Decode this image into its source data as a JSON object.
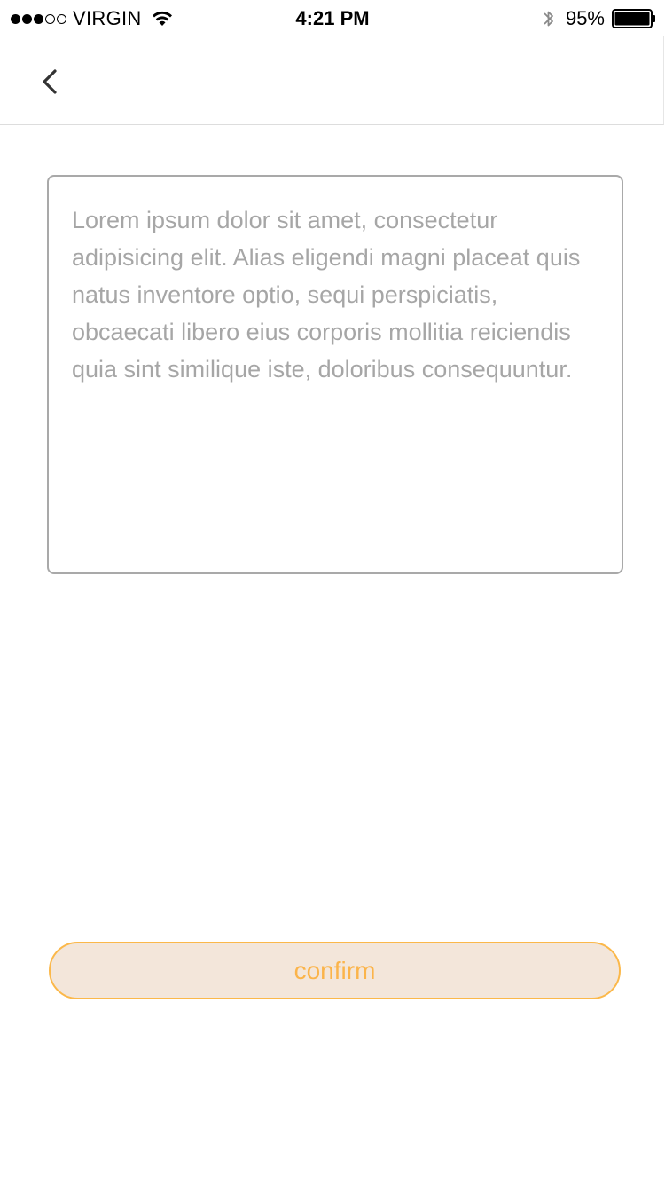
{
  "status_bar": {
    "carrier": "VIRGIN",
    "signal": {
      "filled": 3,
      "empty": 2
    },
    "time": "4:21 PM",
    "battery_percent": "95%",
    "icons": [
      "signal-dots-icon",
      "wifi-icon",
      "bluetooth-icon",
      "battery-icon"
    ]
  },
  "nav": {
    "back_icon": "chevron-left-icon"
  },
  "editor": {
    "text": "Lorem ipsum dolor sit amet, consectetur adipisicing elit. Alias eligendi magni placeat quis natus inventore optio, sequi perspiciatis, obcaecati libero eius corporis mollitia reiciendis quia sint similique iste, doloribus consequuntur."
  },
  "actions": {
    "confirm_label": "confirm"
  },
  "colors": {
    "accent": "#fbb44a",
    "button_bg": "#f3e6da",
    "text_gray": "#a6a6a6",
    "border_gray": "#a9a9a9"
  }
}
